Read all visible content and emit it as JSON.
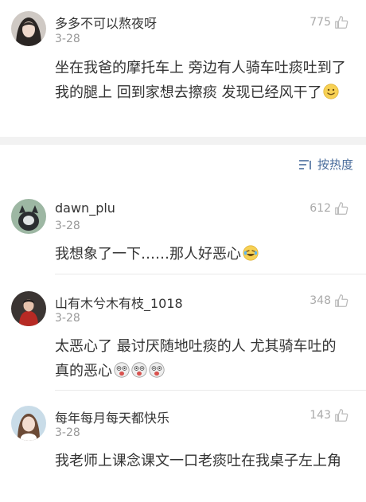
{
  "top_comment": {
    "username": "多多不可以熬夜呀",
    "date": "3-28",
    "likes": "775",
    "text": "坐在我爸的摩托车上 旁边有人骑车吐痰吐到了我的腿上 回到家想去擦痰 发现已经风干了"
  },
  "sort": {
    "label": "按热度",
    "icon": "sort-icon"
  },
  "comments": [
    {
      "username": "dawn_plu",
      "date": "3-28",
      "likes": "612",
      "text": "我想象了一下……那人好恶心"
    },
    {
      "username": "山有木兮木有枝_1018",
      "date": "3-28",
      "likes": "348",
      "text": "太恶心了 最讨厌随地吐痰的人 尤其骑车吐的 真的恶心"
    },
    {
      "username": "每年每月每天都快乐",
      "date": "3-28",
      "likes": "143",
      "text": "我老师上课念课文一口老痰吐在我桌子左上角"
    }
  ]
}
